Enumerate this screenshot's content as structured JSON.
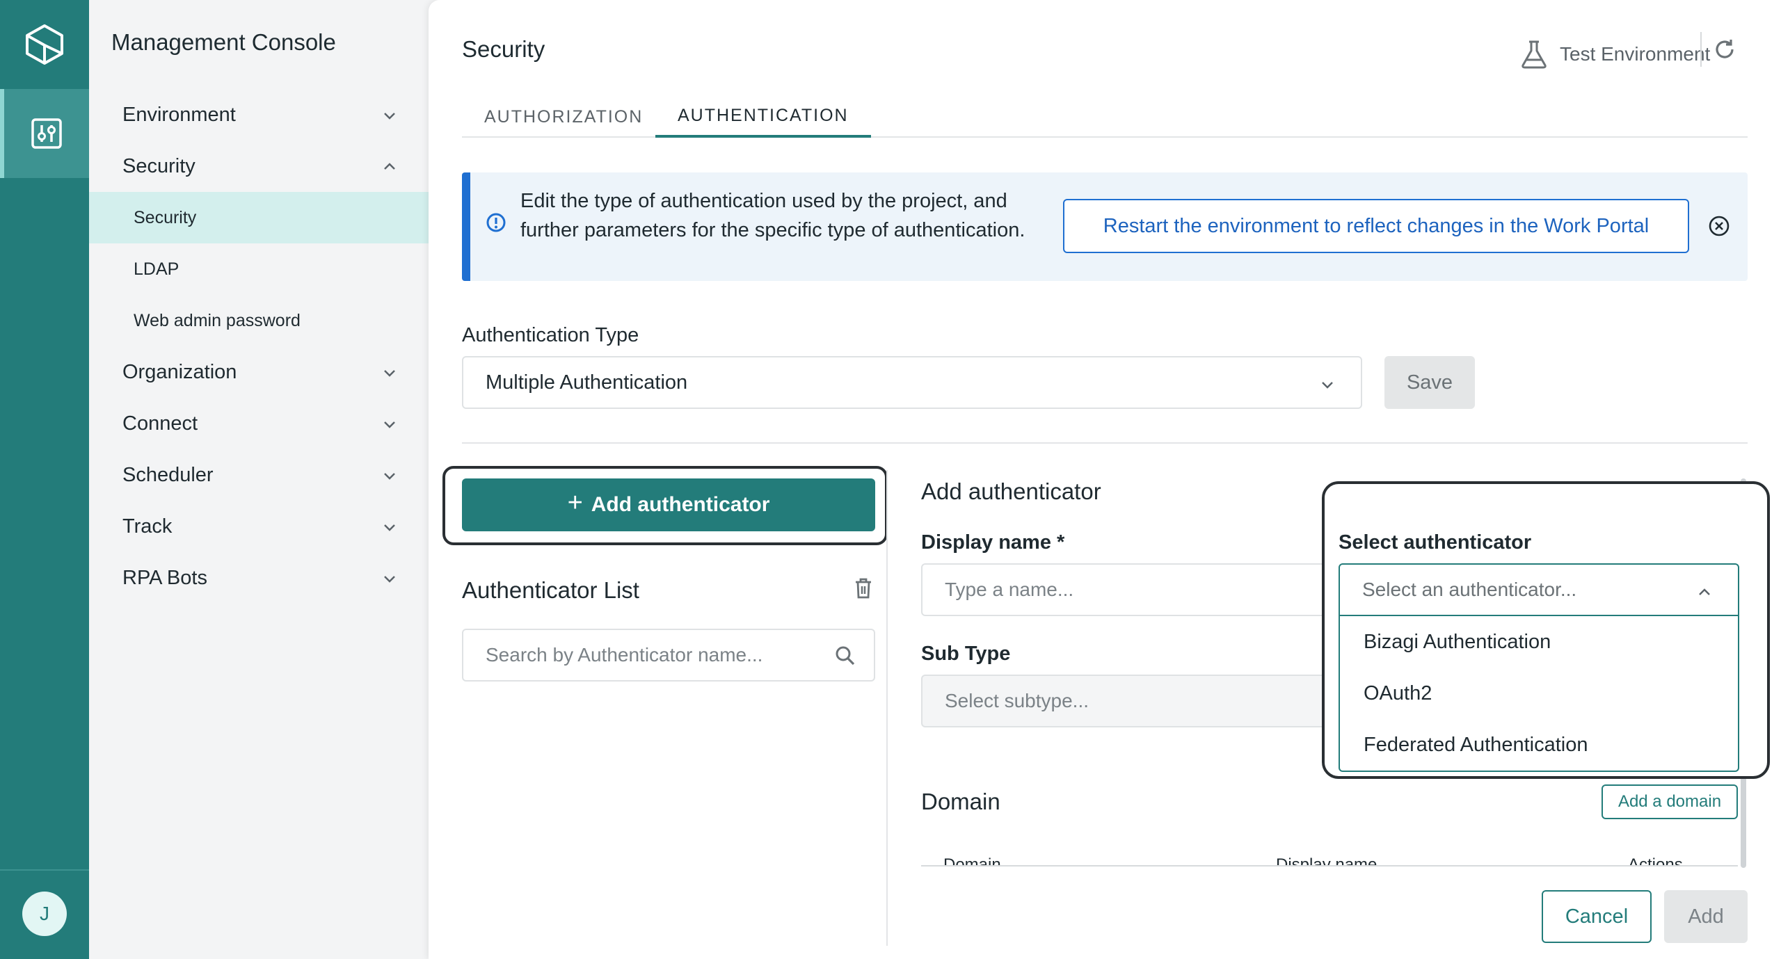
{
  "rail": {
    "avatar_initial": "J"
  },
  "sidebar": {
    "title": "Management Console",
    "items": [
      {
        "label": "Environment",
        "expanded": false
      },
      {
        "label": "Security",
        "expanded": true
      },
      {
        "label": "Organization",
        "expanded": false
      },
      {
        "label": "Connect",
        "expanded": false
      },
      {
        "label": "Scheduler",
        "expanded": false
      },
      {
        "label": "Track",
        "expanded": false
      },
      {
        "label": "RPA Bots",
        "expanded": false
      }
    ],
    "security_sub": [
      "Security",
      "LDAP",
      "Web admin password"
    ],
    "active_sub": "Security"
  },
  "header": {
    "title": "Security",
    "environment": "Test Environment"
  },
  "tabs": [
    {
      "label": "AUTHORIZATION",
      "active": false
    },
    {
      "label": "AUTHENTICATION",
      "active": true
    }
  ],
  "banner": {
    "text": "Edit the type of authentication used by the project, and further parameters for the specific type of authentication.",
    "button": "Restart the environment to reflect changes in the Work Portal"
  },
  "auth_type": {
    "label": "Authentication Type",
    "value": "Multiple Authentication",
    "save": "Save"
  },
  "left_panel": {
    "add_button": "Add authenticator",
    "list_title": "Authenticator List",
    "search_placeholder": "Search by Authenticator name..."
  },
  "form": {
    "title": "Add authenticator",
    "display_name_label": "Display name *",
    "display_name_placeholder": "Type a name...",
    "subtype_label": "Sub Type",
    "subtype_placeholder": "Select subtype...",
    "domain_title": "Domain",
    "add_domain": "Add a domain",
    "table_headers": [
      "Domain",
      "Display name",
      "Actions"
    ],
    "cancel": "Cancel",
    "add": "Add"
  },
  "select_authenticator": {
    "label": "Select authenticator",
    "placeholder": "Select an authenticator...",
    "options": [
      "Bizagi Authentication",
      "OAuth2",
      "Federated Authentication"
    ]
  },
  "colors": {
    "teal": "#237c7a",
    "blue": "#1f6fd1"
  }
}
